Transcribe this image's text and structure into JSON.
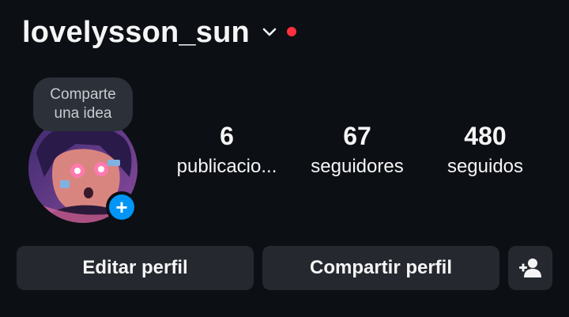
{
  "header": {
    "username": "lovelysson_sun",
    "accent_dot_color": "#ff3040",
    "account_switch_icon": "chevron-down-icon"
  },
  "note": {
    "line1": "Comparte",
    "line2": "una idea"
  },
  "avatar": {
    "add_story_icon": "plus-icon",
    "add_story_glyph": "+",
    "add_story_color": "#0095f6"
  },
  "stats": {
    "posts": {
      "value": "6",
      "label": "publicacio..."
    },
    "followers": {
      "value": "67",
      "label": "seguidores"
    },
    "following": {
      "value": "480",
      "label": "seguidos"
    }
  },
  "actions": {
    "edit_label": "Editar perfil",
    "share_label": "Compartir perfil",
    "discover_icon": "add-person-icon"
  }
}
